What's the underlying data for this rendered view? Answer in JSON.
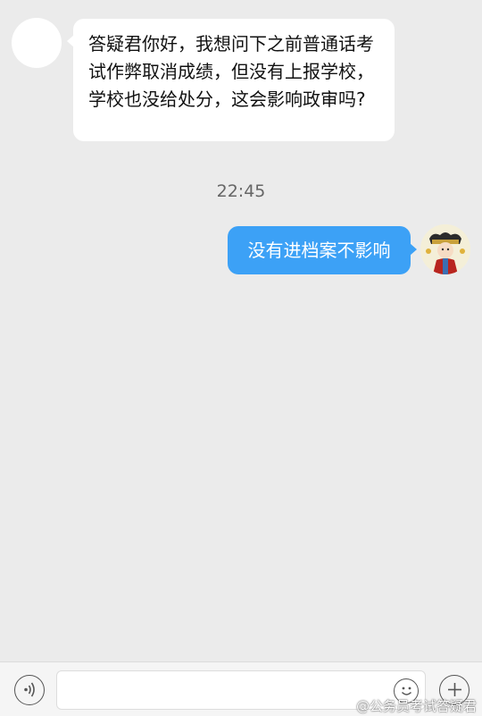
{
  "conversation": {
    "incoming_message": "答疑君你好，我想问下之前普通话考试作弊取消成绩，但没有上报学校，学校也没给处分，这会影响政审吗?",
    "timestamp": "22:45",
    "outgoing_message": "没有进档案不影响"
  },
  "colors": {
    "background": "#ebebeb",
    "incoming_bubble": "#ffffff",
    "outgoing_bubble": "#3ca1f6"
  },
  "input_bar": {
    "voice_icon": "voice-icon",
    "emoji_icon": "emoji-icon",
    "plus_icon": "plus-icon",
    "input_value": "",
    "input_placeholder": ""
  },
  "watermark": "@公务员考试答疑君"
}
